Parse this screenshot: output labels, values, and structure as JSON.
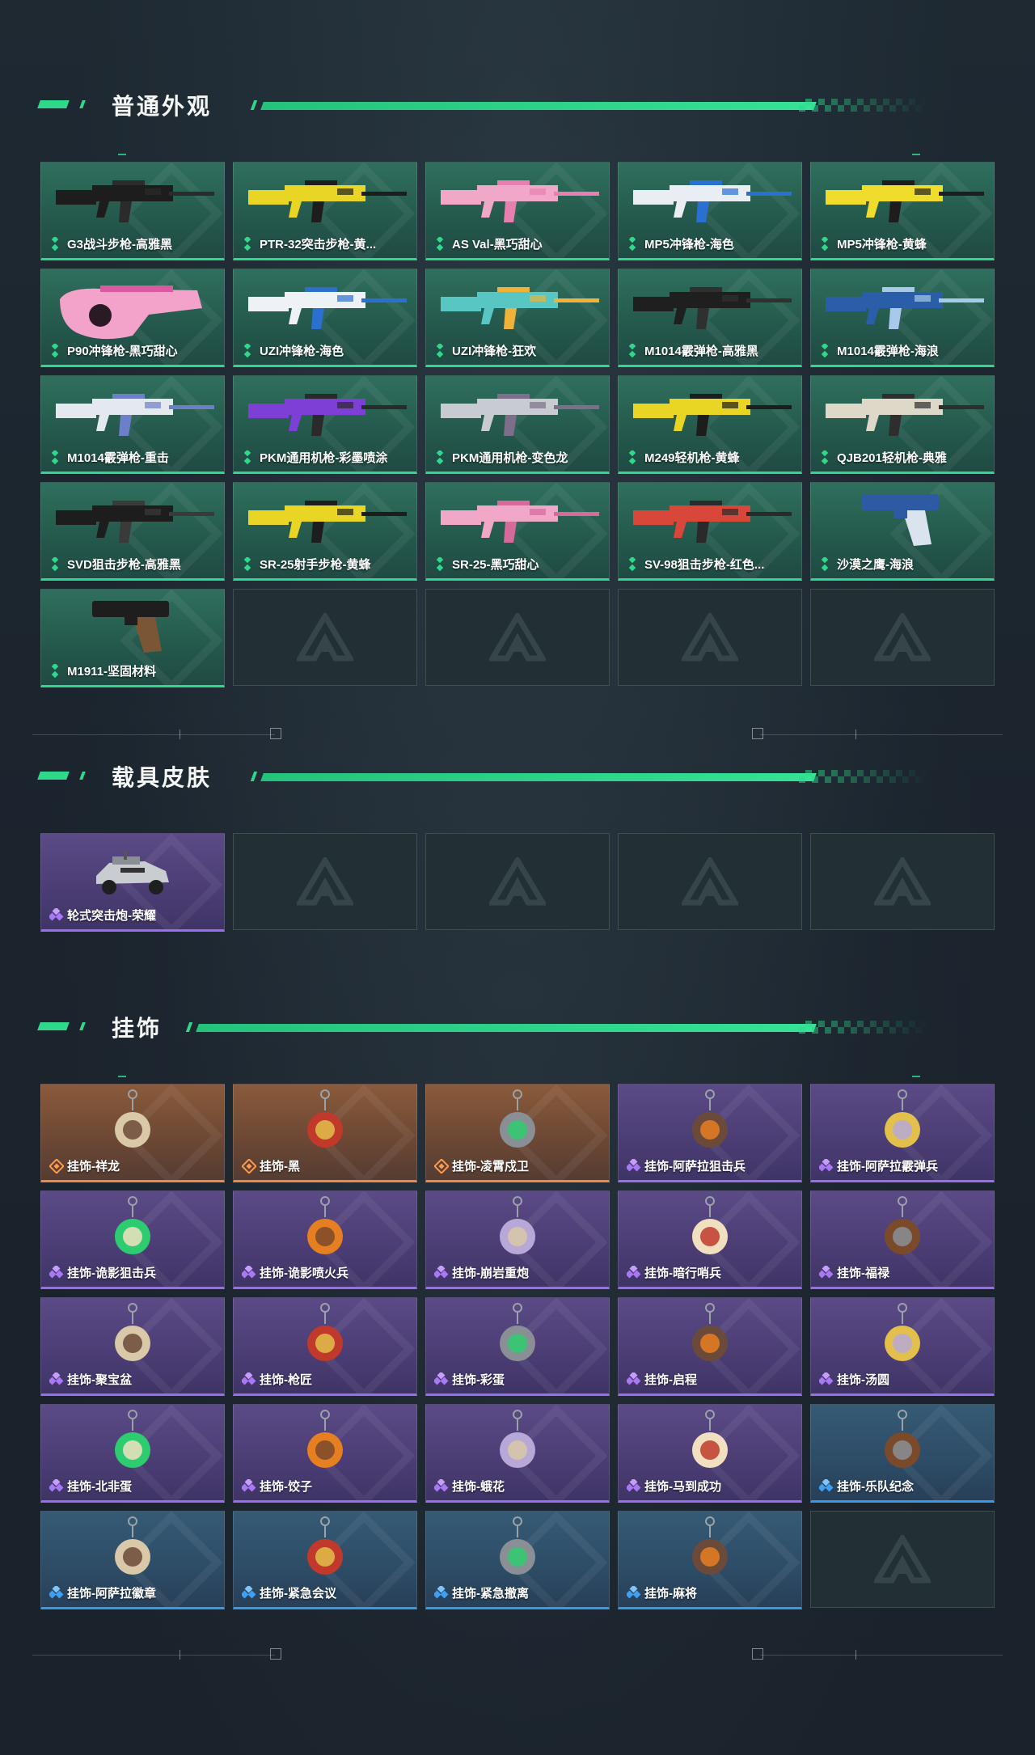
{
  "colors": {
    "accent": "#2fd98c",
    "green_card": "#2f6f5d",
    "purple_card": "#5b4a86",
    "orange_card": "#8a5a3b",
    "blue_card": "#365a75"
  },
  "sections": [
    {
      "title": "普通外观",
      "items": [
        {
          "label": "G3战斗步枪-高雅黑",
          "rarity": "green",
          "art": "rifle-black"
        },
        {
          "label": "PTR-32突击步枪-黄...",
          "rarity": "green",
          "art": "rifle-yellow"
        },
        {
          "label": "AS Val-黑巧甜心",
          "rarity": "green",
          "art": "rifle-pink"
        },
        {
          "label": "MP5冲锋枪-海色",
          "rarity": "green",
          "art": "smg-white"
        },
        {
          "label": "MP5冲锋枪-黄蜂",
          "rarity": "green",
          "art": "smg-yellow"
        },
        {
          "label": "P90冲锋枪-黑巧甜心",
          "rarity": "green",
          "art": "p90-pink"
        },
        {
          "label": "UZI冲锋枪-海色",
          "rarity": "green",
          "art": "uzi-white"
        },
        {
          "label": "UZI冲锋枪-狂欢",
          "rarity": "green",
          "art": "uzi-color"
        },
        {
          "label": "M1014霰弹枪-高雅黑",
          "rarity": "green",
          "art": "shotgun-black"
        },
        {
          "label": "M1014霰弹枪-海浪",
          "rarity": "green",
          "art": "shotgun-blue"
        },
        {
          "label": "M1014霰弹枪-重击",
          "rarity": "green",
          "art": "shotgun-white"
        },
        {
          "label": "PKM通用机枪-彩墨喷涂",
          "rarity": "green",
          "art": "lmg-purple"
        },
        {
          "label": "PKM通用机枪-变色龙",
          "rarity": "green",
          "art": "lmg-grey"
        },
        {
          "label": "M249轻机枪-黄蜂",
          "rarity": "green",
          "art": "lmg-yellow"
        },
        {
          "label": "QJB201轻机枪-典雅",
          "rarity": "green",
          "art": "lmg-white"
        },
        {
          "label": "SVD狙击步枪-高雅黑",
          "rarity": "green",
          "art": "sniper-black"
        },
        {
          "label": "SR-25射手步枪-黄蜂",
          "rarity": "green",
          "art": "sniper-yellow"
        },
        {
          "label": "SR-25-黑巧甜心",
          "rarity": "green",
          "art": "sniper-pink"
        },
        {
          "label": "SV-98狙击步枪-红色...",
          "rarity": "green",
          "art": "sniper-red"
        },
        {
          "label": "沙漠之鹰-海浪",
          "rarity": "green",
          "art": "pistol-blue"
        },
        {
          "label": "M1911-坚固材料",
          "rarity": "green",
          "art": "pistol-black"
        },
        {
          "label": "",
          "rarity": "empty"
        },
        {
          "label": "",
          "rarity": "empty"
        },
        {
          "label": "",
          "rarity": "empty"
        },
        {
          "label": "",
          "rarity": "empty"
        }
      ]
    },
    {
      "title": "载具皮肤",
      "items": [
        {
          "label": "轮式突击炮-荣耀",
          "rarity": "purple",
          "art": "vehicle"
        },
        {
          "label": "",
          "rarity": "empty"
        },
        {
          "label": "",
          "rarity": "empty"
        },
        {
          "label": "",
          "rarity": "empty"
        },
        {
          "label": "",
          "rarity": "empty"
        }
      ]
    },
    {
      "title": "挂饰",
      "items": [
        {
          "label": "挂饰-祥龙",
          "rarity": "orange",
          "art": "charm"
        },
        {
          "label": "挂饰-黑",
          "rarity": "orange",
          "art": "charm"
        },
        {
          "label": "挂饰-凌霄戍卫",
          "rarity": "orange",
          "art": "charm"
        },
        {
          "label": "挂饰-阿萨拉狙击兵",
          "rarity": "purple",
          "art": "charm"
        },
        {
          "label": "挂饰-阿萨拉霰弹兵",
          "rarity": "purple",
          "art": "charm"
        },
        {
          "label": "挂饰-诡影狙击兵",
          "rarity": "purple",
          "art": "charm"
        },
        {
          "label": "挂饰-诡影喷火兵",
          "rarity": "purple",
          "art": "charm"
        },
        {
          "label": "挂饰-崩岩重炮",
          "rarity": "purple",
          "art": "charm"
        },
        {
          "label": "挂饰-暗行哨兵",
          "rarity": "purple",
          "art": "charm"
        },
        {
          "label": "挂饰-福禄",
          "rarity": "purple",
          "art": "charm"
        },
        {
          "label": "挂饰-聚宝盆",
          "rarity": "purple",
          "art": "charm"
        },
        {
          "label": "挂饰-枪匠",
          "rarity": "purple",
          "art": "charm"
        },
        {
          "label": "挂饰-彩蛋",
          "rarity": "purple",
          "art": "charm"
        },
        {
          "label": "挂饰-启程",
          "rarity": "purple",
          "art": "charm"
        },
        {
          "label": "挂饰-汤圆",
          "rarity": "purple",
          "art": "charm"
        },
        {
          "label": "挂饰-北非蛋",
          "rarity": "purple",
          "art": "charm"
        },
        {
          "label": "挂饰-饺子",
          "rarity": "purple",
          "art": "charm"
        },
        {
          "label": "挂饰-蛾花",
          "rarity": "purple",
          "art": "charm"
        },
        {
          "label": "挂饰-马到成功",
          "rarity": "purple",
          "art": "charm"
        },
        {
          "label": "挂饰-乐队纪念",
          "rarity": "blue",
          "art": "charm"
        },
        {
          "label": "挂饰-阿萨拉徽章",
          "rarity": "blue",
          "art": "charm"
        },
        {
          "label": "挂饰-紧急会议",
          "rarity": "blue",
          "art": "charm"
        },
        {
          "label": "挂饰-紧急撤离",
          "rarity": "blue",
          "art": "charm"
        },
        {
          "label": "挂饰-麻将",
          "rarity": "blue",
          "art": "charm"
        },
        {
          "label": "",
          "rarity": "empty"
        }
      ]
    }
  ]
}
